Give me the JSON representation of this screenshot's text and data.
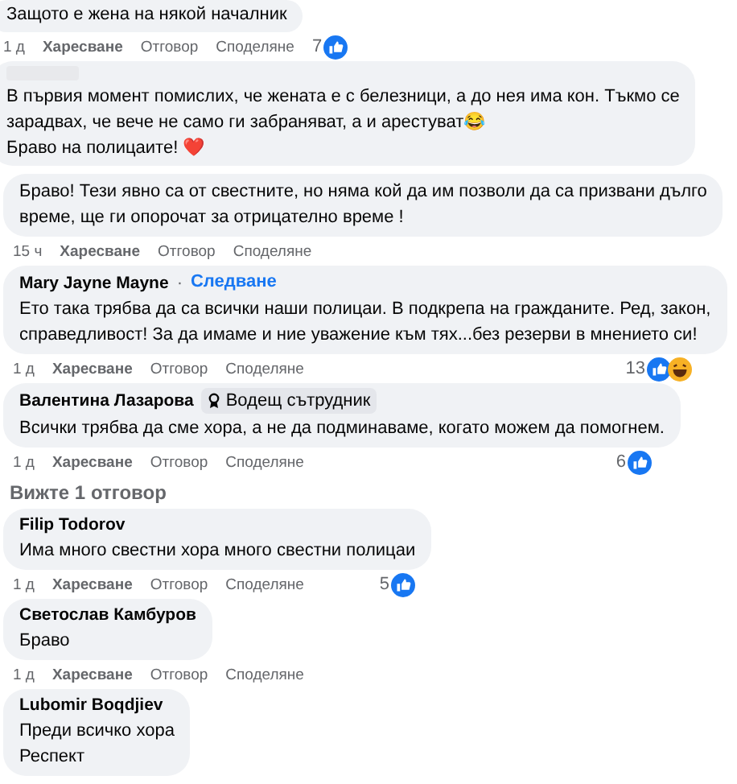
{
  "comments": [
    {
      "text": "Защото е жена на някой началник",
      "time": "1 д",
      "actions": [
        "Харесване",
        "Отговор",
        "Споделяне"
      ],
      "count": "7",
      "reactions": [
        {
          "kind": "like"
        }
      ]
    },
    {
      "text": "В първия момент помислих, че жената е с белезници, а до нея има кон. Тъкмо се\nзарадвах, че вече не само ги забраняват, а и арестуват😂\nБраво на полицаите! ❤️",
      "redacted_name": true
    },
    {
      "text": "Браво! Тези явно са от свестните, но няма кой да им позволи да са призвани дълго\nвреме, ще ги опорочат за отрицателно време !",
      "time": "15 ч",
      "actions": [
        "Харесване",
        "Отговор",
        "Споделяне"
      ]
    },
    {
      "name": "Mary Jayne Mayne",
      "separator": "·",
      "follow": "Следване",
      "text": "Ето така трябва да са всички наши полицаи. В подкрепа на гражданите. Ред, закон,\nсправедливост! За да имаме и ние уважение към тях...без резерви в мнението си!",
      "time": "1 д",
      "actions": [
        "Харесване",
        "Отговор",
        "Споделяне"
      ],
      "count": "13",
      "reactions": [
        {
          "kind": "like"
        },
        {
          "kind": "haha"
        }
      ]
    },
    {
      "name": "Валентина Лазарова",
      "badge": "Водещ сътрудник",
      "text": "Всички трябва да сме хора, а не да подминаваме, когато можем да помогнем.",
      "time": "1 д",
      "actions": [
        "Харесване",
        "Отговор",
        "Споделяне"
      ],
      "count": "6",
      "reactions": [
        {
          "kind": "like"
        }
      ]
    }
  ],
  "view_replies": "Вижте 1 отговор",
  "replies": [
    {
      "name": "Filip Todorov",
      "text": "Има много свестни хора много свестни полицаи",
      "time": "1 д",
      "actions": [
        "Харесване",
        "Отговор",
        "Споделяне"
      ],
      "count": "5",
      "reactions": [
        {
          "kind": "like"
        }
      ]
    },
    {
      "name": "Светослав Камбуров",
      "text": "Браво",
      "time": "1 д",
      "actions": [
        "Харесване",
        "Отговор",
        "Споделяне"
      ]
    },
    {
      "name": "Lubomir Boqdjiev",
      "text": "Преди всичко хора\nРеспект"
    }
  ]
}
